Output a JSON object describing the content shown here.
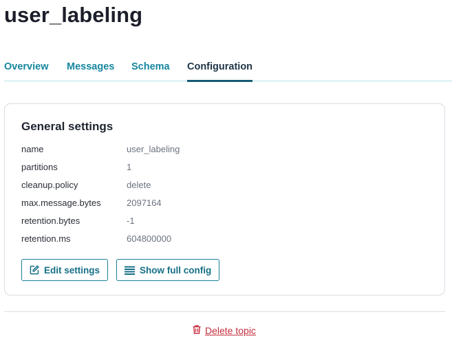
{
  "page": {
    "title": "user_labeling"
  },
  "tabs": [
    {
      "label": "Overview",
      "active": false
    },
    {
      "label": "Messages",
      "active": false
    },
    {
      "label": "Schema",
      "active": false
    },
    {
      "label": "Configuration",
      "active": true
    }
  ],
  "general_settings": {
    "title": "General settings",
    "rows": [
      {
        "key": "name",
        "value": "user_labeling"
      },
      {
        "key": "partitions",
        "value": "1"
      },
      {
        "key": "cleanup.policy",
        "value": "delete"
      },
      {
        "key": "max.message.bytes",
        "value": "2097164"
      },
      {
        "key": "retention.bytes",
        "value": "-1"
      },
      {
        "key": "retention.ms",
        "value": "604800000"
      }
    ],
    "edit_button": {
      "label": "Edit settings",
      "icon": "edit-icon"
    },
    "config_button": {
      "label": "Show full config",
      "icon": "list-icon"
    }
  },
  "delete": {
    "label": "Delete topic",
    "icon": "trash-icon"
  },
  "colors": {
    "accent": "#17869e",
    "active_tab_underline": "#165a74",
    "danger": "#c62d3c"
  }
}
